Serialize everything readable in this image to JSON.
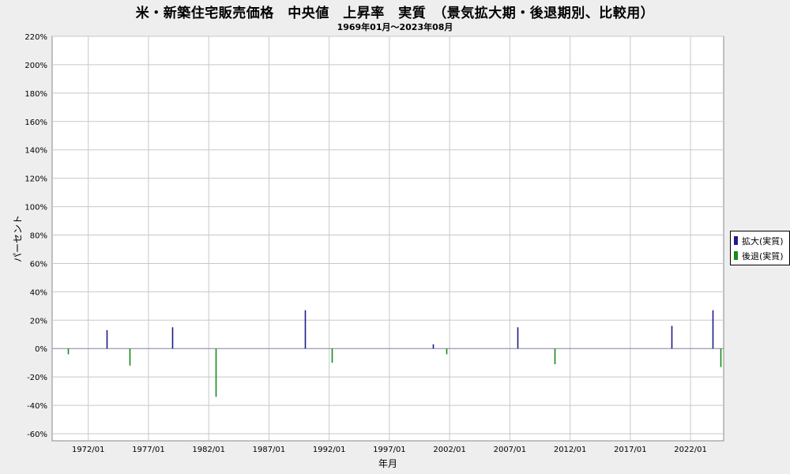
{
  "chart_data": {
    "type": "bar",
    "title": "米・新築住宅販売価格　中央値　上昇率　実質　（景気拡大期・後退期別、比較用）",
    "subtitle": "1969年01月～2023年08月",
    "xlabel": "年月",
    "ylabel": "パーセント",
    "ylim": [
      -65,
      220
    ],
    "yticks": [
      -60,
      -40,
      -20,
      0,
      20,
      40,
      60,
      80,
      100,
      120,
      140,
      160,
      180,
      200,
      220
    ],
    "ytick_suffix": "%",
    "xlim": [
      1969.0,
      2024.75
    ],
    "xticks": [
      "1972/01",
      "1977/01",
      "1982/01",
      "1987/01",
      "1992/01",
      "1997/01",
      "2002/01",
      "2007/01",
      "2012/01",
      "2017/01",
      "2022/01"
    ],
    "grid": true,
    "legend_position": "right",
    "series": [
      {
        "name": "拡大(実質)",
        "color": "#1c1c8c",
        "points": [
          {
            "x": 1973.5,
            "y": 13
          },
          {
            "x": 1979.0,
            "y": 15
          },
          {
            "x": 1990.0,
            "y": 27
          },
          {
            "x": 2000.6,
            "y": 3
          },
          {
            "x": 2007.6,
            "y": 15
          },
          {
            "x": 2020.4,
            "y": 16
          },
          {
            "x": 2023.8,
            "y": 27
          }
        ]
      },
      {
        "name": "後退(実質)",
        "color": "#178a17",
        "points": [
          {
            "x": 1970.3,
            "y": -4
          },
          {
            "x": 1975.4,
            "y": -12
          },
          {
            "x": 1982.6,
            "y": -34
          },
          {
            "x": 1992.2,
            "y": -10
          },
          {
            "x": 2001.7,
            "y": -4
          },
          {
            "x": 2010.7,
            "y": -11
          },
          {
            "x": 2024.5,
            "y": -13
          }
        ]
      }
    ]
  }
}
